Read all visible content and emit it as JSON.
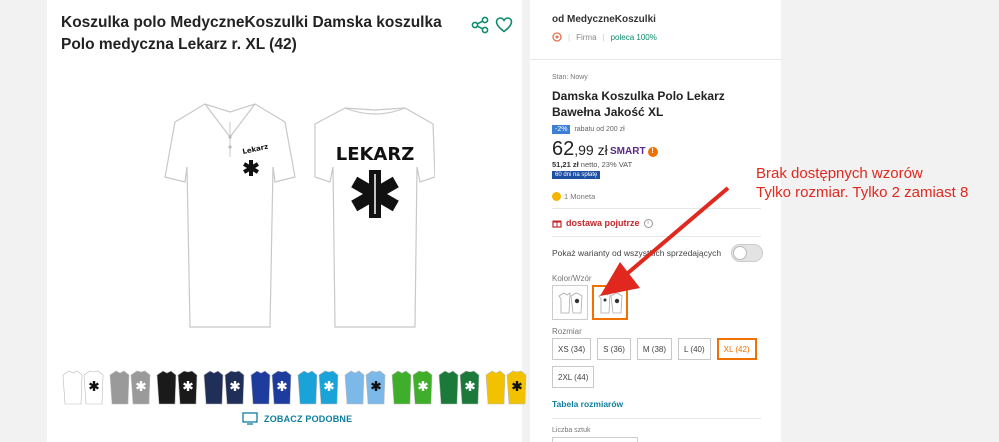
{
  "product_header": {
    "title": "Koszulka polo MedyczneKoszulki Damska koszulka Polo medyczna Lekarz r. XL (42)"
  },
  "print_text": "LEKARZ",
  "print_text_small": "Lekarz",
  "similar_label": "ZOBACZ PODOBNE",
  "thumbnail_colors": [
    "#ffffff",
    "#9a9a9a",
    "#1a1a1a",
    "#1f2f57",
    "#1e3b9e",
    "#1aa3d8",
    "#7cb8e8",
    "#3fae2a",
    "#1b7a3a",
    "#f2c200"
  ],
  "seller": {
    "name": "od MedyczneKoszulki",
    "type": "Firma",
    "recommend": "poleca 100%"
  },
  "offer": {
    "state": "Stan: Nowy",
    "name": "Damska Koszulka Polo Lekarz Bawełna Jakość XL",
    "discount_badge": "-2%",
    "discount_text": "rabatu od 200 zł",
    "price_main": "62",
    "price_frac": ",99 zł",
    "smart_label": "SMART",
    "smart_mark": "!",
    "netto_value": "51,21 zł",
    "netto_text": "netto, 23% VAT",
    "installment": "60 dni na spłatę",
    "coin_text": "1 Moneta"
  },
  "delivery": {
    "text": "dostawa pojutrze",
    "info": "i"
  },
  "variants": {
    "toggle_label": "Pokaż warianty od wszystkich sprzedających",
    "color_label": "Kolor/Wzór",
    "size_label": "Rozmiar",
    "sizes": [
      "XS (34)",
      "S (36)",
      "M (38)",
      "L (40)",
      "XL (42)",
      "2XL (44)"
    ],
    "selected_size": "XL (42)",
    "size_table": "Tabela rozmiarów",
    "qty_label": "Liczba sztuk"
  },
  "annotation": {
    "line1": "Brak dostępnych wzorów",
    "line2": "Tylko rozmiar. Tylko 2 zamiast 8"
  },
  "colors": {
    "accent": "#f07000",
    "link": "#0d7ea0",
    "annotation": "#e0281f"
  }
}
